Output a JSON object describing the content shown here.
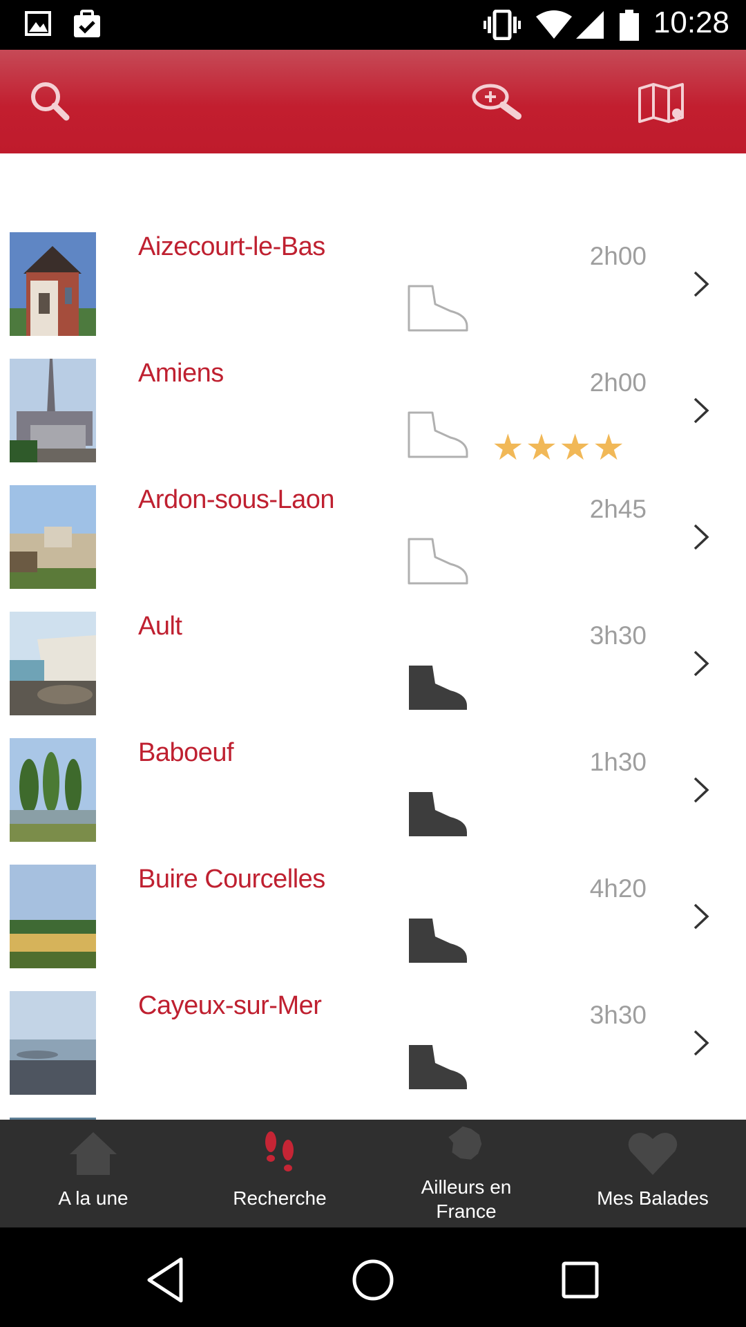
{
  "status_bar": {
    "time": "10:28",
    "icons": [
      "image-icon",
      "clipboard-check-icon",
      "vibrate-icon",
      "wifi-icon",
      "signal-icon",
      "battery-icon"
    ]
  },
  "app_bar": {
    "color": "#c21e2f",
    "actions": [
      "search-icon",
      "zoom-in-icon",
      "map-icon"
    ]
  },
  "balades": [
    {
      "name": "Aizecourt-le-Bas",
      "duration": "2h00",
      "boot": "outline",
      "stars": 0,
      "thumb": "church"
    },
    {
      "name": "Amiens",
      "duration": "2h00",
      "boot": "outline",
      "stars": 4,
      "thumb": "cathedral"
    },
    {
      "name": "Ardon-sous-Laon",
      "duration": "2h45",
      "boot": "outline",
      "stars": 0,
      "thumb": "ramparts"
    },
    {
      "name": "Ault",
      "duration": "3h30",
      "boot": "filled",
      "stars": 0,
      "thumb": "cliff"
    },
    {
      "name": "Baboeuf",
      "duration": "1h30",
      "boot": "filled",
      "stars": 0,
      "thumb": "poplars"
    },
    {
      "name": "Buire Courcelles",
      "duration": "4h20",
      "boot": "filled",
      "stars": 0,
      "thumb": "fields"
    },
    {
      "name": "Cayeux-sur-Mer",
      "duration": "3h30",
      "boot": "filled",
      "stars": 0,
      "thumb": "beach"
    }
  ],
  "bottom_nav": {
    "items": [
      {
        "label": "A la une",
        "icon": "home-icon",
        "active": false
      },
      {
        "label": "Recherche",
        "icon": "footprints-icon",
        "active": true
      },
      {
        "label_line1": "Ailleurs en",
        "label_line2": "France",
        "icon": "france-map-icon",
        "active": false
      },
      {
        "label": "Mes Balades",
        "icon": "heart-icon",
        "active": false
      }
    ]
  },
  "colors": {
    "accent": "#bf2030",
    "star": "#f1b857",
    "duration": "#9e9e9e",
    "nav_bg": "#2f2f2f"
  }
}
